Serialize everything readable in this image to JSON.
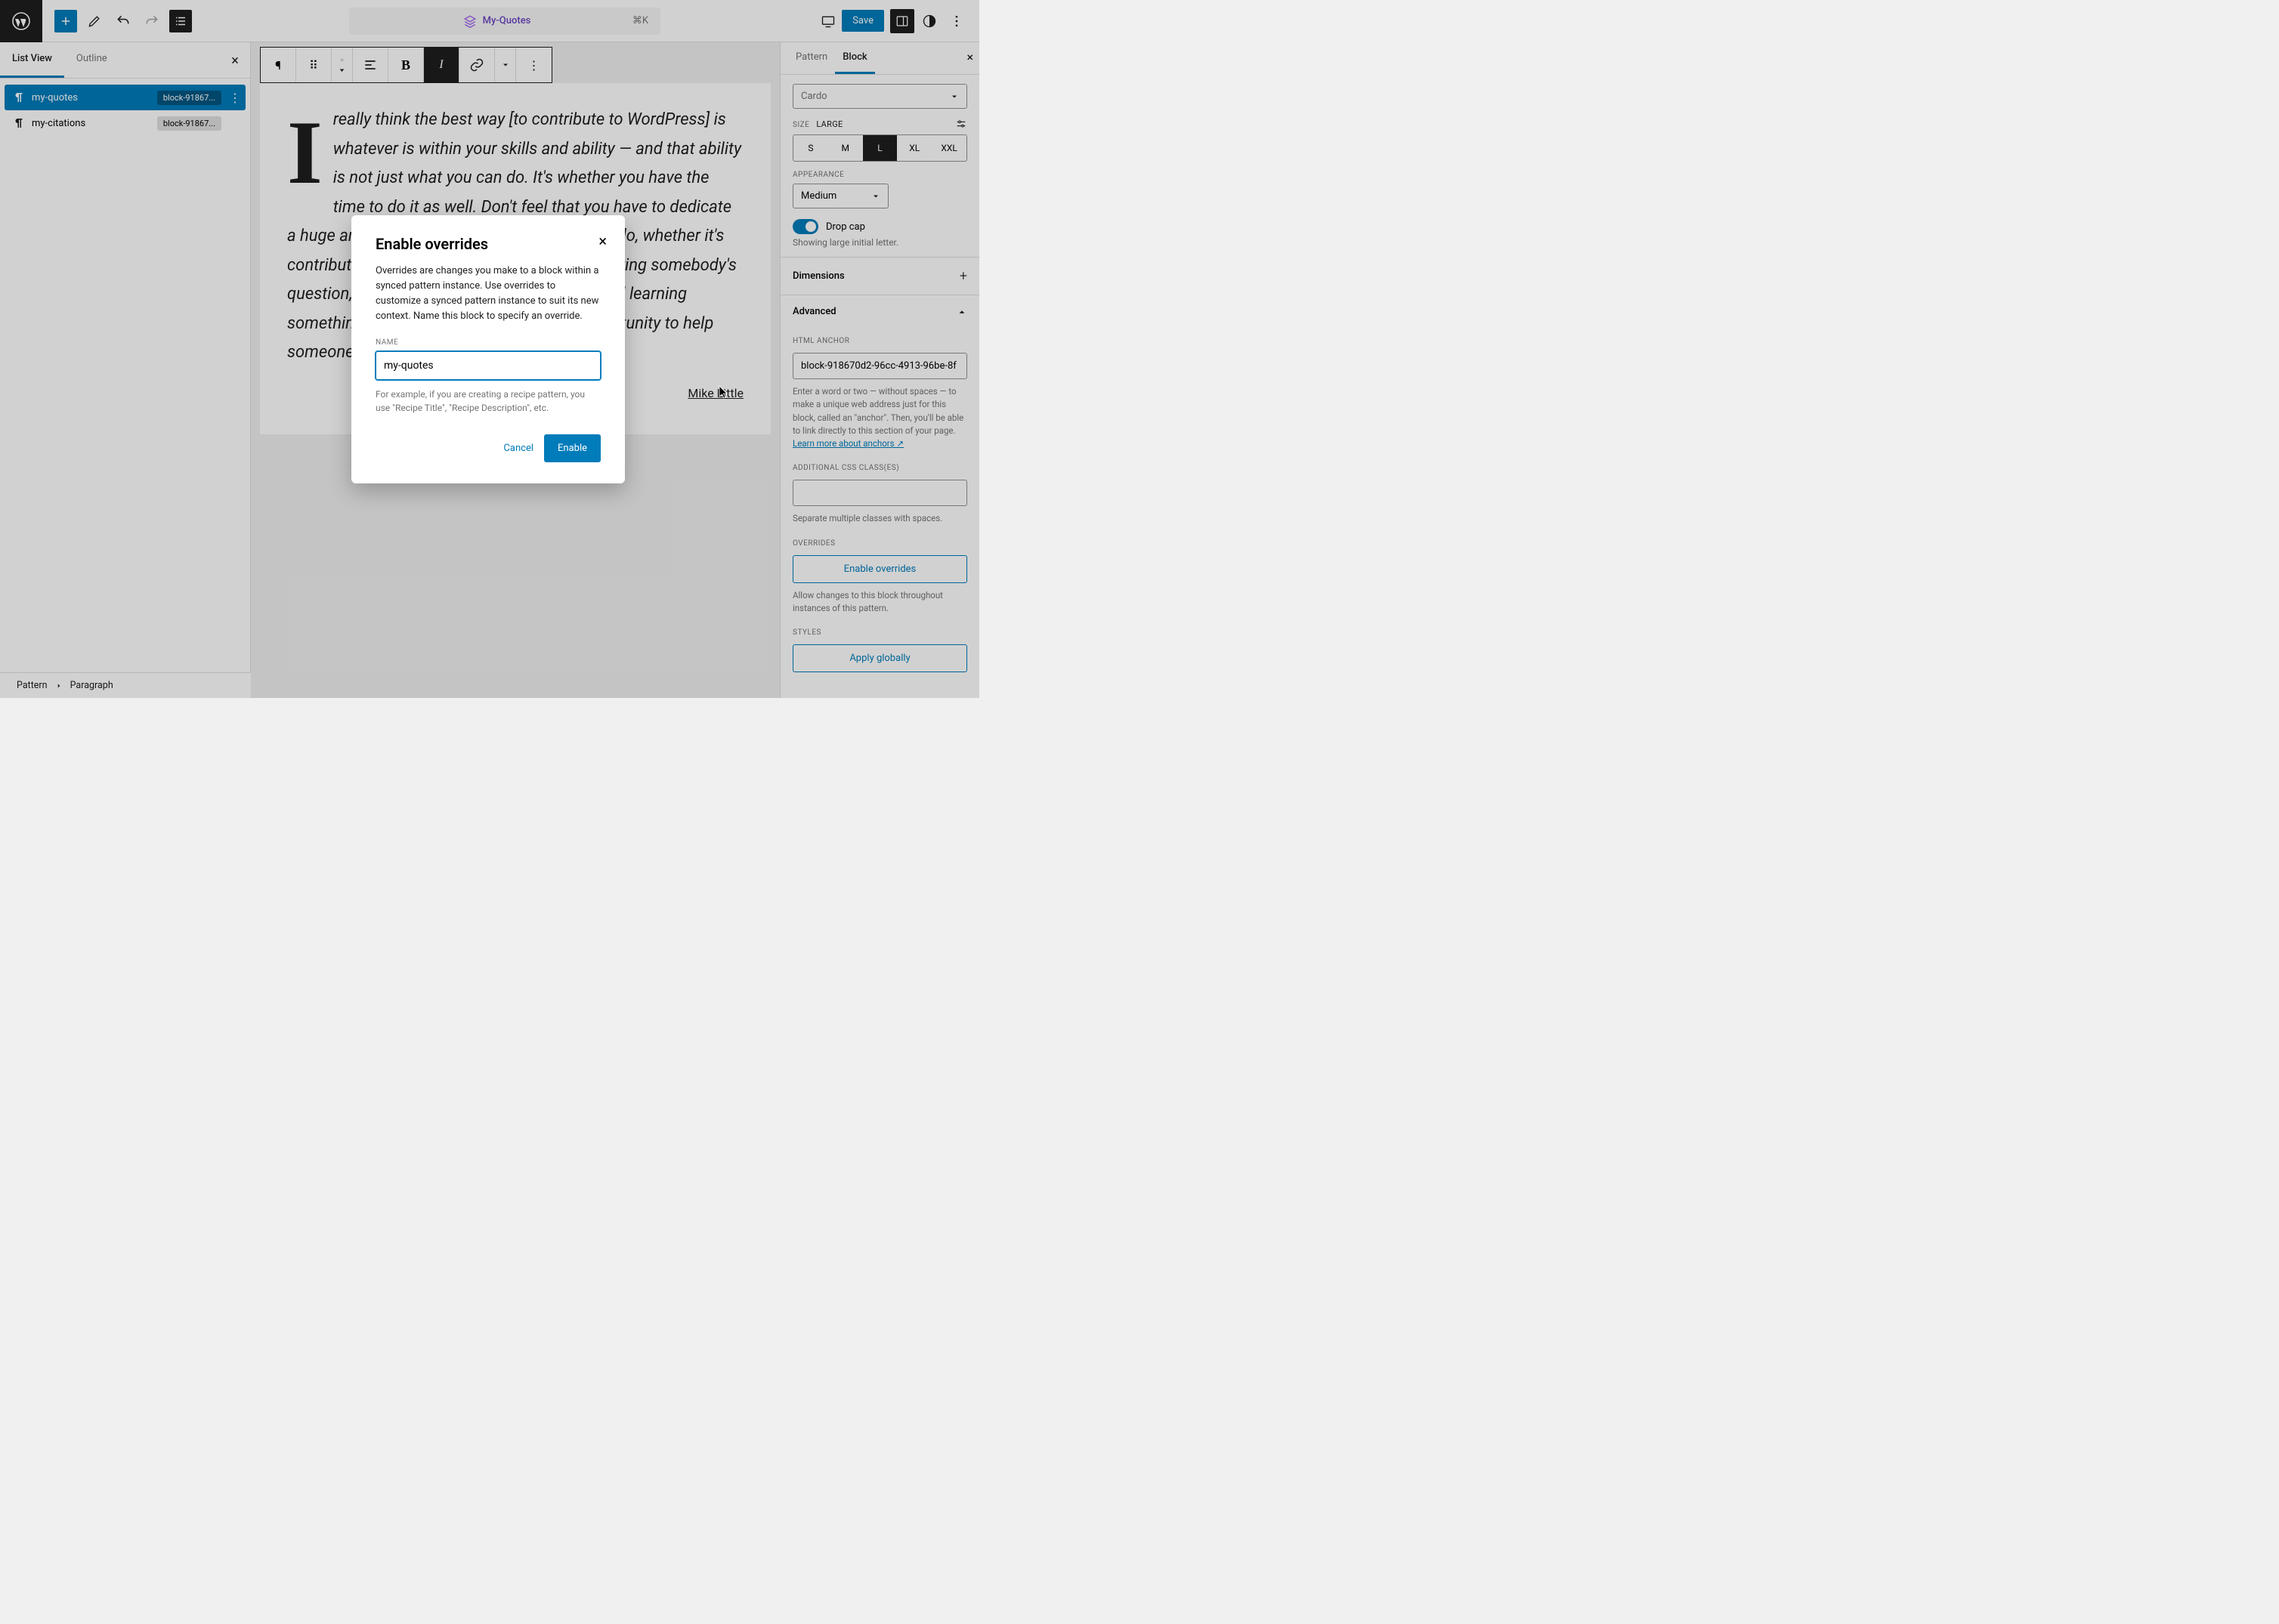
{
  "topbar": {
    "doc_title": "My-Quotes",
    "kb_shortcut": "⌘K",
    "save_label": "Save"
  },
  "left_panel": {
    "tabs": {
      "list_view": "List View",
      "outline": "Outline"
    },
    "items": [
      {
        "label": "my-quotes",
        "chip": "block-91867..."
      },
      {
        "label": "my-citations",
        "chip": "block-91867..."
      }
    ]
  },
  "content": {
    "dropcap": "I",
    "body": " really think the best way [to contribute to WordPress] is whatever is within your skills and ability — and that ability is not just what you can do. It's whether you have the time to do it as well. Don't feel that you have to dedicate a huge amount of time. Anything that you can do, whether it's contributing on the support forums and answering somebody's question, to going along to a meetup group and learning something so that you can then take the opportunity to help someone else.",
    "cite": "Mike Little"
  },
  "right_panel": {
    "tabs": {
      "pattern": "Pattern",
      "block": "Block"
    },
    "font_name": "Cardo",
    "size_label": "Size",
    "size_current": "Large",
    "sizes": [
      "S",
      "M",
      "L",
      "XL",
      "XXL"
    ],
    "appearance_label": "Appearance",
    "appearance_value": "Medium",
    "dropcap_label": "Drop cap",
    "dropcap_hint": "Showing large initial letter.",
    "dimensions_label": "Dimensions",
    "advanced_label": "Advanced",
    "html_anchor_label": "HTML Anchor",
    "html_anchor_value": "block-918670d2-96cc-4913-96be-8f",
    "html_anchor_help": "Enter a word or two — without spaces — to make a unique web address just for this block, called an \"anchor\". Then, you'll be able to link directly to this section of your page. ",
    "html_anchor_link": "Learn more about anchors ↗",
    "css_label": "Additional CSS Class(es)",
    "css_help": "Separate multiple classes with spaces.",
    "overrides_label": "Overrides",
    "overrides_btn": "Enable overrides",
    "overrides_help": "Allow changes to this block throughout instances of this pattern.",
    "styles_label": "Styles",
    "apply_globally": "Apply globally"
  },
  "breadcrumb": {
    "a": "Pattern",
    "b": "Paragraph"
  },
  "modal": {
    "title": "Enable overrides",
    "desc": "Overrides are changes you make to a block within a synced pattern instance. Use overrides to customize a synced pattern instance to suit its new context. Name this block to specify an override.",
    "name_label": "Name",
    "name_value": "my-quotes",
    "hint": "For example, if you are creating a recipe pattern, you use \"Recipe Title\", \"Recipe Description\", etc.",
    "cancel": "Cancel",
    "enable": "Enable"
  }
}
